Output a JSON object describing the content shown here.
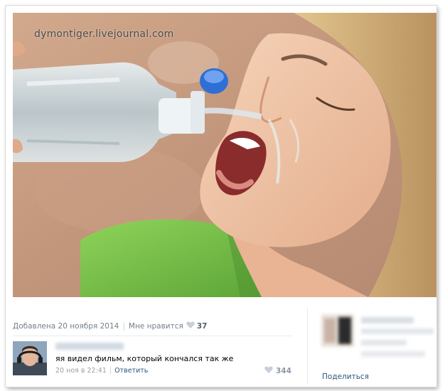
{
  "photo": {
    "watermark": "dymontiger.livejournal.com"
  },
  "post": {
    "added_label": "Добавлена 20 ноября 2014",
    "dislike_label": "Мне нравится",
    "like_count": "37"
  },
  "comment": {
    "text": "яя видел фильм, который кончался так же",
    "date": "20 ноя в 22:41",
    "reply_label": "Ответить",
    "like_count": "344"
  },
  "sidebar": {
    "share_label": "Поделиться"
  },
  "colors": {
    "link": "#2b587a",
    "meta": "#737f8c",
    "shirt": "#7cc44a",
    "skin": "#efc3a4",
    "hair": "#cfae79",
    "bottle_cap": "#2d6fd6"
  }
}
